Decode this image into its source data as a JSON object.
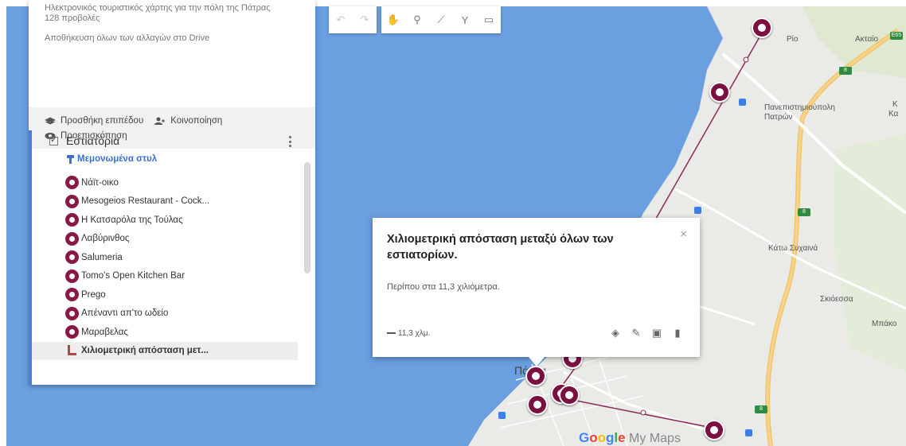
{
  "sidebar": {
    "description": "Ηλεκτρονικός τουριστικός χάρτης για την πόλη της Πάτρας",
    "views": "128 προβολές",
    "save_status": "Αποθήκευση όλων των αλλαγών στο Drive",
    "actions": {
      "add_layer": "Προσθήκη επιπέδου",
      "share": "Κοινοποίηση",
      "preview": "Προεπισκόπηση"
    },
    "layer": {
      "title": "Εστιατόρια",
      "style_link": "Μεμονωμένα στυλ",
      "items": [
        "Νάϊτ-οικο",
        "Mesogeios Restaurant - Cock...",
        "Η Κατσαρόλα της Τούλας",
        "Λαβύρινθος",
        "Salumeria",
        "Tomo's Open Kitchen Bar",
        "Prego",
        "Απέναντι απ'το ωδείο",
        "Μαραβελας"
      ],
      "measure_item": "Χιλιομετρική απόσταση μετ..."
    }
  },
  "toolbar": {
    "undo": "↶",
    "redo": "↷",
    "hand": "✋",
    "marker": "⚲",
    "draw_line": "⟋",
    "directions": "Y",
    "measure": "▭"
  },
  "popup": {
    "title": "Χιλιομετρική απόσταση μεταξύ όλων των εστιατορίων.",
    "distance_text": "Περίπου στα 11,3 χιλιόμετρα.",
    "length": "11,3 χλμ.",
    "close": "×"
  },
  "map": {
    "places": {
      "rio": "Ρίο",
      "aktaio": "Ακταίο",
      "university": "Πανεπιστημιούπολη Πατρών",
      "kato_sychaina": "Κάτω Συχαινά",
      "skioessa": "Σκιόεσσα",
      "bpako": "Μπάκο",
      "patra": "Πάτρα",
      "k1": "Κ",
      "k2": "Κα"
    },
    "badges": {
      "e1": "E65",
      "e2": "8",
      "e3": "8",
      "e4": "8"
    }
  },
  "logo": {
    "google": "Google",
    "mymaps": " My Maps"
  },
  "colors": {
    "water": "#6a9fe0",
    "land": "#eaeae6",
    "marker": "#7b1040",
    "accent": "#4a7fd8"
  }
}
